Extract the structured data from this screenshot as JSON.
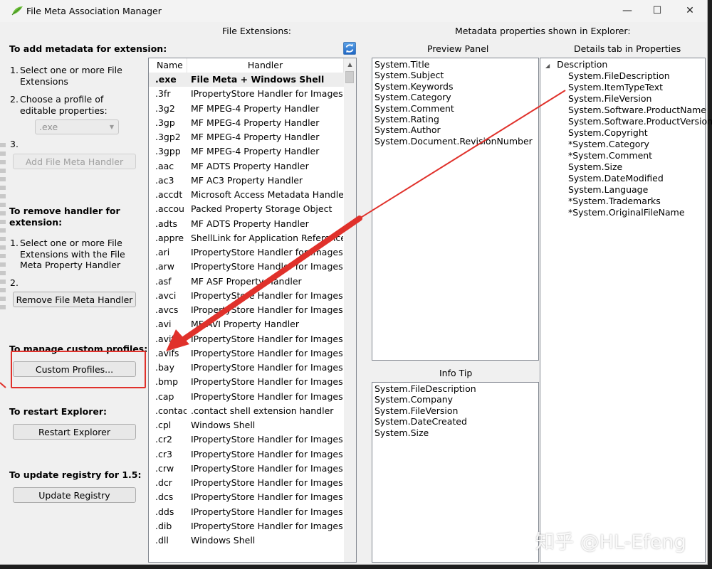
{
  "window": {
    "title": "File Meta Association Manager",
    "controls": {
      "minimize": "—",
      "maximize": "☐",
      "close": "✕"
    }
  },
  "headers": {
    "file_extensions": "File Extensions:",
    "metadata_shown": "Metadata properties shown in Explorer:",
    "preview_panel": "Preview Panel",
    "details_tab": "Details tab in Properties",
    "info_tip": "Info Tip"
  },
  "left_panel": {
    "add_title": "To add metadata for extension:",
    "add_steps": [
      {
        "num": "1.",
        "text": "Select one or more File Extensions"
      },
      {
        "num": "2.",
        "text": "Choose a profile of editable properties:"
      },
      {
        "num": "3.",
        "text": ""
      }
    ],
    "profile_combo_value": ".exe",
    "add_button": "Add File Meta Handler",
    "remove_title": "To remove handler for extension:",
    "remove_steps": [
      {
        "num": "1.",
        "text": "Select one or more File Extensions with the File Meta Property Handler"
      },
      {
        "num": "2.",
        "text": ""
      }
    ],
    "remove_button": "Remove File Meta Handler",
    "profiles_title": "To manage custom profiles:",
    "profiles_button": "Custom Profiles...",
    "restart_title": "To restart Explorer:",
    "restart_button": "Restart Explorer",
    "registry_title": "To update registry for 1.5:",
    "registry_button": "Update Registry"
  },
  "extension_table": {
    "columns": [
      "Name",
      "Handler"
    ],
    "rows": [
      {
        "ext": ".exe",
        "handler": "File Meta + Windows Shell",
        "selected": true
      },
      {
        "ext": ".3fr",
        "handler": "IPropertyStore Handler for Images"
      },
      {
        "ext": ".3g2",
        "handler": "MF MPEG-4 Property Handler"
      },
      {
        "ext": ".3gp",
        "handler": "MF MPEG-4 Property Handler"
      },
      {
        "ext": ".3gp2",
        "handler": "MF MPEG-4 Property Handler"
      },
      {
        "ext": ".3gpp",
        "handler": "MF MPEG-4 Property Handler"
      },
      {
        "ext": ".aac",
        "handler": "MF ADTS Property Handler"
      },
      {
        "ext": ".ac3",
        "handler": "MF AC3 Property Handler"
      },
      {
        "ext": ".accdt",
        "handler": "Microsoft Access Metadata Handler"
      },
      {
        "ext": ".accou",
        "handler": "Packed Property Storage Object"
      },
      {
        "ext": ".adts",
        "handler": "MF ADTS Property Handler"
      },
      {
        "ext": ".appre",
        "handler": "ShellLink for Application References"
      },
      {
        "ext": ".ari",
        "handler": "IPropertyStore Handler for Images"
      },
      {
        "ext": ".arw",
        "handler": "IPropertyStore Handler for Images"
      },
      {
        "ext": ".asf",
        "handler": "MF ASF Property Handler"
      },
      {
        "ext": ".avci",
        "handler": "IPropertyStore Handler for Images"
      },
      {
        "ext": ".avcs",
        "handler": "IPropertyStore Handler for Images"
      },
      {
        "ext": ".avi",
        "handler": "MF AVI Property Handler"
      },
      {
        "ext": ".avif",
        "handler": "IPropertyStore Handler for Images"
      },
      {
        "ext": ".avifs",
        "handler": "IPropertyStore Handler for Images"
      },
      {
        "ext": ".bay",
        "handler": "IPropertyStore Handler for Images"
      },
      {
        "ext": ".bmp",
        "handler": "IPropertyStore Handler for Images"
      },
      {
        "ext": ".cap",
        "handler": "IPropertyStore Handler for Images"
      },
      {
        "ext": ".contac",
        "handler": ".contact shell extension handler"
      },
      {
        "ext": ".cpl",
        "handler": "Windows Shell"
      },
      {
        "ext": ".cr2",
        "handler": "IPropertyStore Handler for Images"
      },
      {
        "ext": ".cr3",
        "handler": "IPropertyStore Handler for Images"
      },
      {
        "ext": ".crw",
        "handler": "IPropertyStore Handler for Images"
      },
      {
        "ext": ".dcr",
        "handler": "IPropertyStore Handler for Images"
      },
      {
        "ext": ".dcs",
        "handler": "IPropertyStore Handler for Images"
      },
      {
        "ext": ".dds",
        "handler": "IPropertyStore Handler for Images"
      },
      {
        "ext": ".dib",
        "handler": "IPropertyStore Handler for Images"
      },
      {
        "ext": ".dll",
        "handler": "Windows Shell"
      }
    ]
  },
  "preview_panel_items": [
    "System.Title",
    "System.Subject",
    "System.Keywords",
    "System.Category",
    "System.Comment",
    "System.Rating",
    "System.Author",
    "System.Document.RevisionNumber"
  ],
  "info_tip_items": [
    "System.FileDescription",
    "System.Company",
    "System.FileVersion",
    "System.DateCreated",
    "System.Size"
  ],
  "details_tab": {
    "root": "Description",
    "items": [
      "System.FileDescription",
      "System.ItemTypeText",
      "System.FileVersion",
      "System.Software.ProductName",
      "System.Software.ProductVersion",
      "System.Copyright",
      "*System.Category",
      "*System.Comment",
      "System.Size",
      "System.DateModified",
      "System.Language",
      "*System.Trademarks",
      "*System.OriginalFileName"
    ]
  },
  "watermark": "知乎 @HL-Efeng",
  "colors": {
    "annotation_red": "#e0312b",
    "window_bg": "#f0f0f0"
  }
}
